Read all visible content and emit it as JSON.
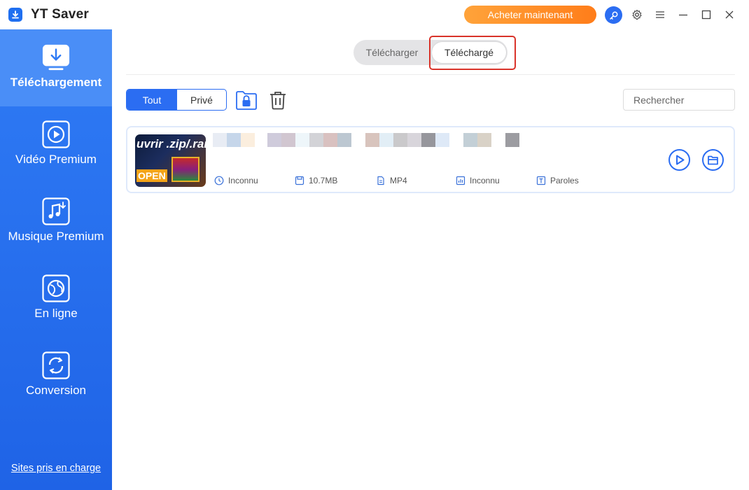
{
  "app": {
    "title": "YT Saver",
    "buy_label": "Acheter maintenant",
    "accent": "#2b6df2",
    "buy_color": "#ff8c26"
  },
  "titlebar_icons": [
    "key-icon",
    "gear-icon",
    "menu-icon",
    "minimize-icon",
    "maximize-icon",
    "close-icon"
  ],
  "sidebar": {
    "items": [
      {
        "label": "Téléchargement",
        "icon": "download-icon",
        "active": true
      },
      {
        "label": "Vidéo Premium",
        "icon": "play-icon",
        "active": false
      },
      {
        "label": "Musique Premium",
        "icon": "music-icon",
        "active": false
      },
      {
        "label": "En ligne",
        "icon": "globe-icon",
        "active": false
      },
      {
        "label": "Conversion",
        "icon": "convert-icon",
        "active": false
      }
    ],
    "footer_link": "Sites pris en charge"
  },
  "tabs": {
    "left": "Télécharger",
    "right": "Téléchargé",
    "selected": "Téléchargé"
  },
  "filter": {
    "all": "Tout",
    "private": "Privé",
    "selected": "Tout"
  },
  "search": {
    "placeholder": "Rechercher",
    "value": ""
  },
  "items": [
    {
      "thumbnail_text": "uvrir .zip/.rar",
      "thumbnail_badge": "OPEN",
      "duration": "Inconnu",
      "size": "10.7MB",
      "format": "MP4",
      "quality": "Inconnu",
      "subtitles": "Paroles"
    }
  ]
}
